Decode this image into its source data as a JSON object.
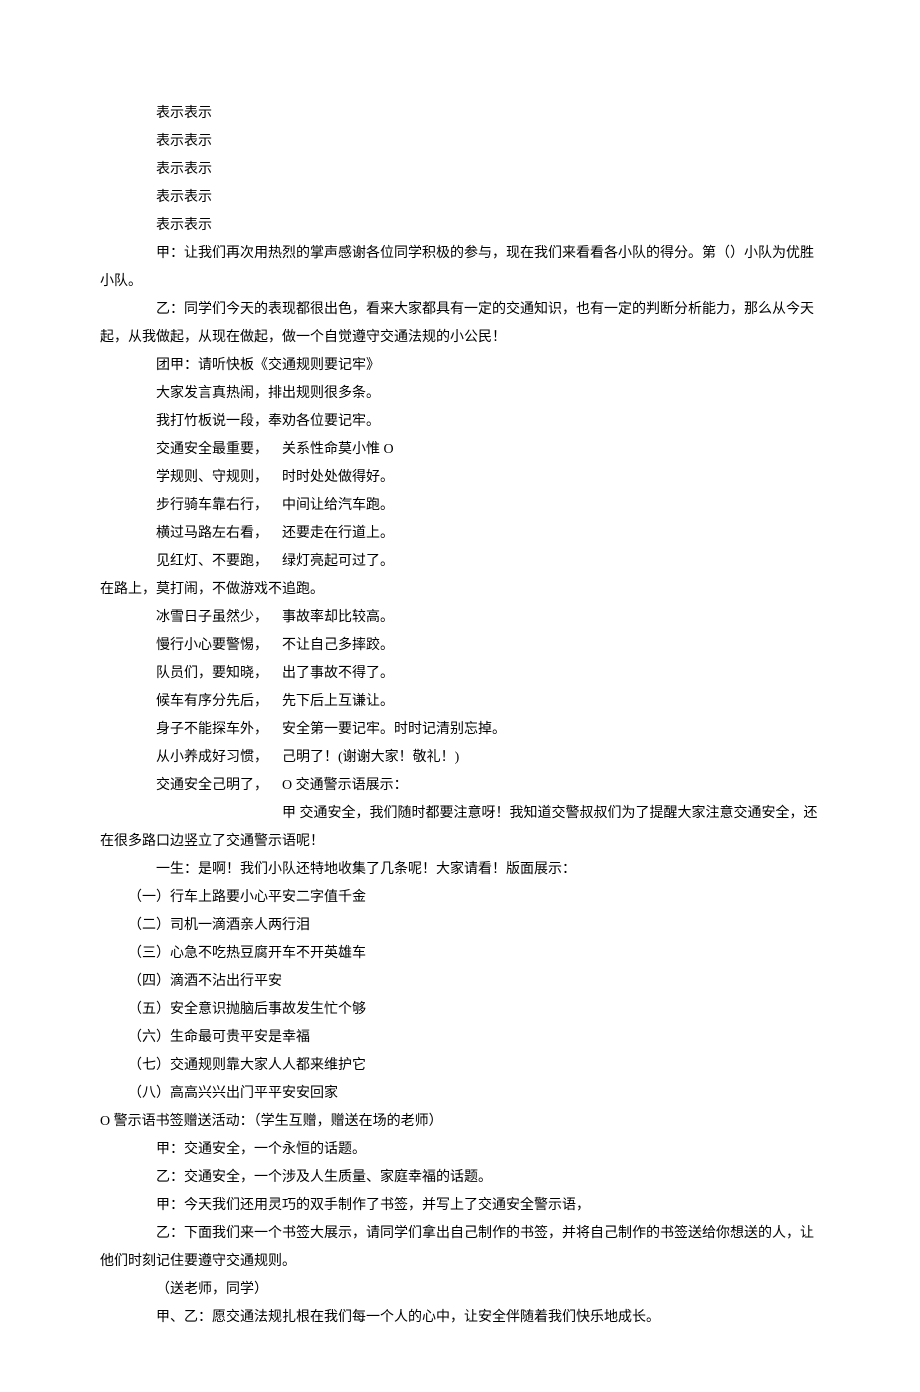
{
  "repeat": [
    "表示表示",
    "表示表示",
    "表示表示",
    "表示表示",
    "表示表示"
  ],
  "jia1": "甲：让我们再次用热烈的掌声感谢各位同学积极的参与，现在我们来看看各小队的得分。第（）小队为优胜小队。",
  "yi1": "乙：同学们今天的表现都很出色，看来大家都具有一定的交通知识，也有一定的判断分析能力，那么从今天起，从我做起，从现在做起，做一个自觉遵守交通法规的小公民！",
  "tuanjia": "团甲：请听快板《交通规则要记牢》",
  "line_a": "大家发言真热闹，排出规则很多条。",
  "line_b": "我打竹板说一段，奉劝各位要记牢。",
  "pairs_top": [
    {
      "l": "交通安全最重要，",
      "r": "关系性命莫小惟 O"
    },
    {
      "l": "学规则、守规则，",
      "r": "时时处处做得好。"
    },
    {
      "l": "步行骑车靠右行，",
      "r": "中间让给汽车跑。"
    },
    {
      "l": "横过马路左右看，",
      "r": "还要走在行道上。"
    },
    {
      "l": "见红灯、不要跑，",
      "r": "绿灯亮起可过了。"
    }
  ],
  "mid_line": "在路上，莫打闹，不做游戏不追跑。",
  "pairs_bottom": [
    {
      "l": "冰雪日子虽然少，",
      "r": "事故率却比较高。"
    },
    {
      "l": "慢行小心要警惕，",
      "r": "不让自己多摔跤。"
    },
    {
      "l": "队员们，要知晓，",
      "r": "出了事故不得了。"
    },
    {
      "l": "候车有序分先后，",
      "r": "先下后上互谦让。"
    },
    {
      "l": "身子不能探车外，",
      "r": "安全第一要记牢。时时记清别忘掉。"
    },
    {
      "l": "从小养成好习惯，",
      "r": "己明了！(谢谢大家！敬礼！)"
    },
    {
      "l": "交通安全己明了，",
      "r": "O 交通警示语展示："
    }
  ],
  "jia_traffic": "甲 交通安全，我们随时都要注意呀！我知道交警叔叔们为了提醒大家注意交通安全，还在很多路口边竖立了交通警示语呢！",
  "yisheng": "一生：是啊！我们小队还特地收集了几条呢！大家请看！版面展示：",
  "warnings": [
    "（一）行车上路要小心平安二字值千金",
    "（二）司机一滴酒亲人两行泪",
    "（三）心急不吃热豆腐开车不开英雄车",
    "（四）滴酒不沾出行平安",
    "（五）安全意识抛脑后事故发生忙个够",
    "（六）生命最可贵平安是幸福",
    "（七）交通规则靠大家人人都来维护它",
    "（八）高高兴兴出门平平安安回家"
  ],
  "bookmark_title": "O 警示语书签赠送活动：（学生互赠，赠送在场的老师）",
  "jia2": "甲：交通安全，一个永恒的话题。",
  "yi2": "乙：交通安全，一个涉及人生质量、家庭幸福的话题。",
  "jia3": "甲：今天我们还用灵巧的双手制作了书签，并写上了交通安全警示语，",
  "yi3": "乙：下面我们来一个书签大展示，请同学们拿出自己制作的书签，并将自己制作的书签送给你想送的人，让他们时刻记住要遵守交通规则。",
  "send": "（送老师，同学）",
  "jiayi": "甲、乙：愿交通法规扎根在我们每一个人的心中，让安全伴随着我们快乐地成长。"
}
